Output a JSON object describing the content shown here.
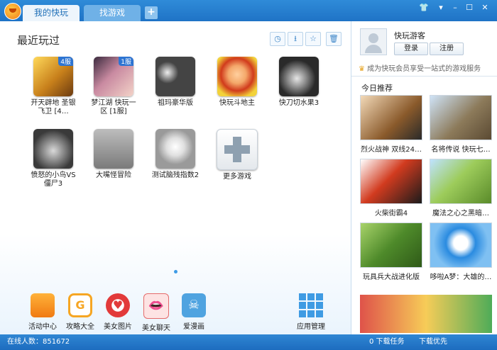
{
  "tabs": [
    {
      "label": "我的快玩"
    },
    {
      "label": "找游戏"
    }
  ],
  "window_controls": [
    "shirt-icon",
    "menu-icon",
    "minimize-icon",
    "maximize-icon",
    "close-icon"
  ],
  "main": {
    "title": "最近玩过",
    "games": [
      {
        "label": "开天辟地 圣银飞卫 [4…",
        "badge": "4服"
      },
      {
        "label": "梦江湖 快玩一区 [1服]",
        "badge": "1服"
      },
      {
        "label": "祖玛豪华版",
        "badge": ""
      },
      {
        "label": "快玩斗地主",
        "badge": ""
      },
      {
        "label": "快刀切水果3",
        "badge": ""
      },
      {
        "label": "愤怒的小鸟VS僵尸3",
        "badge": ""
      },
      {
        "label": "大嘴怪冒险",
        "badge": ""
      },
      {
        "label": "测试脑残指数2",
        "badge": ""
      },
      {
        "label": "更多游戏",
        "badge": ""
      }
    ],
    "bottom": [
      {
        "label": "活动中心"
      },
      {
        "label": "攻略大全"
      },
      {
        "label": "美女图片"
      },
      {
        "label": "美女聊天"
      },
      {
        "label": "爱漫画"
      },
      {
        "label": "应用管理"
      }
    ]
  },
  "side": {
    "username": "快玩游客",
    "login": "登录",
    "register": "注册",
    "vip_text": "成为快玩会员享受一站式的游戏服务",
    "rec_title": "今日推荐",
    "recommends": [
      {
        "label": "烈火战神 双线24…"
      },
      {
        "label": "名将传说 快玩七…"
      },
      {
        "label": "火柴街霸4"
      },
      {
        "label": "魔法之心之黑暗…"
      },
      {
        "label": "玩具兵大战进化版"
      },
      {
        "label": "哆啦A梦：大雄的…"
      }
    ]
  },
  "status": {
    "online_label": "在线人数：",
    "online_count": "851672",
    "tasks": "0 下载任务",
    "speed": "下载优先"
  }
}
